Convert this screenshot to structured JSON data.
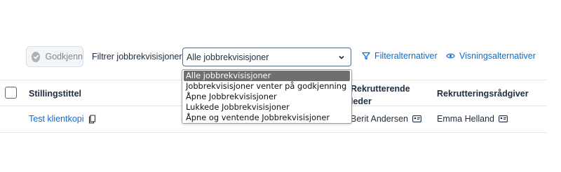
{
  "toolbar": {
    "approve_label": "Godkjenn",
    "filter_label": "Filtrer jobbrekvisisjoner",
    "select_value": "Alle jobbrekvisisjoner",
    "filter_options_label": "Filteralternativer",
    "view_options_label": "Visningsalternativer"
  },
  "dropdown": {
    "options": [
      "Alle jobbrekvisisjoner",
      "Jobbrekvisisjoner venter på godkjenning",
      "Åpne Jobbrekvisisjoner",
      "Lukkede Jobbrekvisisjoner",
      "Åpne og ventende Jobbrekvisisjoner"
    ],
    "selected_index": 0
  },
  "table": {
    "headers": {
      "title": "Stillingstittel",
      "lead": "Rekrutterende leder",
      "advisor": "Rekrutteringsrådgiver"
    },
    "rows": [
      {
        "title": "Test klientkopi",
        "lead": "Berit Andersen",
        "advisor": "Emma Helland"
      }
    ]
  },
  "colors": {
    "link": "#0a6ed1",
    "text": "#1d2d3e",
    "selected_option_bg": "#6f6f6f"
  },
  "icons": {
    "approve": "check-circle-icon",
    "filter": "funnel-icon",
    "view": "eye-icon",
    "copy": "copy-icon",
    "contact_card": "contact-card-icon",
    "dropdown": "chevron-down-icon"
  }
}
